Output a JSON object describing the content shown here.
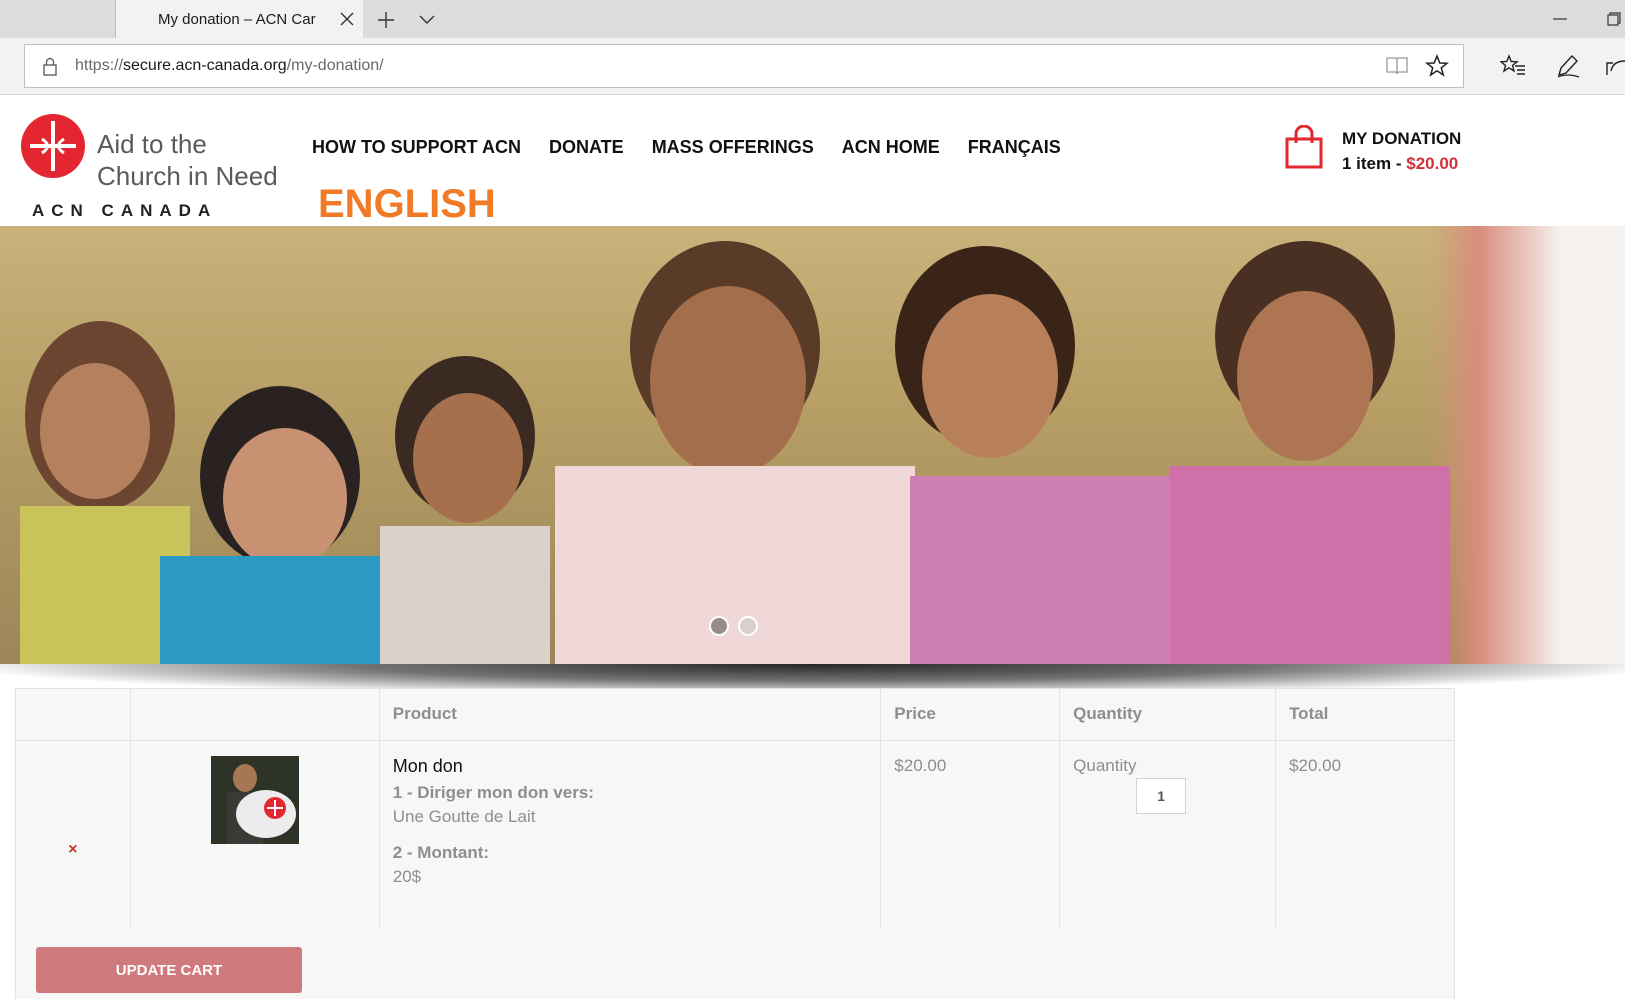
{
  "browser": {
    "tab_title": "My donation – ACN Car",
    "url_scheme": "https://",
    "url_host": "secure.acn-canada.org",
    "url_path": "/my-donation/"
  },
  "site": {
    "logo": {
      "line1": "Aid to the",
      "line2": "Church in Need",
      "line3": "ACN CANADA"
    },
    "nav": [
      "HOW TO SUPPORT ACN",
      "DONATE",
      "MASS OFFERINGS",
      "ACN HOME",
      "FRANÇAIS"
    ],
    "lang_english": "ENGLISH",
    "cart": {
      "title": "MY DONATION",
      "summary_prefix": "1 item - ",
      "summary_amount": "$20.00"
    }
  },
  "hero": {
    "slide_count": 2,
    "active_slide": 1
  },
  "table": {
    "headers": [
      "",
      "",
      "Product",
      "Price",
      "Quantity",
      "Total"
    ],
    "rows": [
      {
        "remove": "×",
        "product_name": "Mon don",
        "opt1_label": "1 - Diriger mon don vers:",
        "opt1_value": "Une Goutte de Lait",
        "opt2_label": "2 - Montant:",
        "opt2_value": "20$",
        "price": "$20.00",
        "qty_label": "Quantity",
        "qty_value": "1",
        "total": "$20.00"
      }
    ],
    "update_label": "UPDATE CART"
  },
  "colors": {
    "accent_orange": "#f07a26",
    "price_red": "#d2323b",
    "button_pink": "#cf7a7c",
    "logo_red": "#e3262f"
  },
  "icons": [
    "lock-icon",
    "close-icon",
    "plus-icon",
    "chevron-down-icon",
    "minimize-icon",
    "restore-icon",
    "reading-view-icon",
    "star-icon",
    "favorites-icon",
    "pen-icon",
    "share-icon",
    "cart-bag-icon",
    "remove-icon"
  ]
}
